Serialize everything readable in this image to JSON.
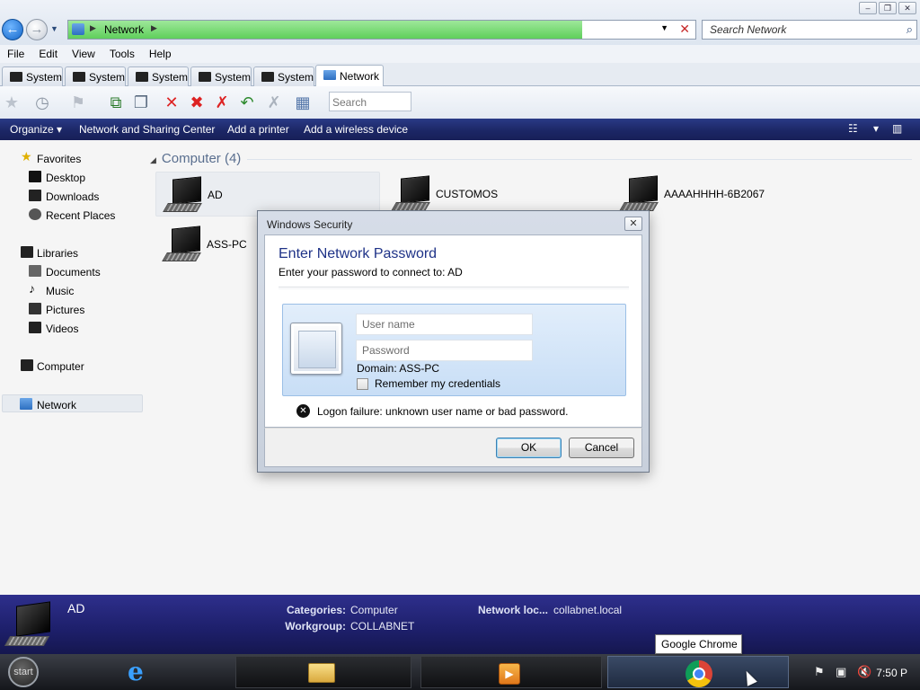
{
  "address_bar": {
    "breadcrumb": "Network",
    "search_placeholder": "Search Network"
  },
  "window_controls": {
    "minimize": "–",
    "maximize": "❐",
    "close": "✕"
  },
  "menu": [
    "File",
    "Edit",
    "View",
    "Tools",
    "Help"
  ],
  "tabs": [
    {
      "label": "System"
    },
    {
      "label": "System"
    },
    {
      "label": "System"
    },
    {
      "label": "System"
    },
    {
      "label": "System"
    },
    {
      "label": "Network",
      "active": true
    }
  ],
  "toolbar": {
    "search_placeholder": "Search"
  },
  "command_bar": {
    "items": [
      "Organize",
      "Network and Sharing Center",
      "Add a printer",
      "Add a wireless device"
    ],
    "organize_arrow": "▾",
    "view_arrow": "▾"
  },
  "nav_pane": {
    "favorites": {
      "label": "Favorites",
      "items": [
        "Desktop",
        "Downloads",
        "Recent Places"
      ]
    },
    "libraries": {
      "label": "Libraries",
      "items": [
        "Documents",
        "Music",
        "Pictures",
        "Videos"
      ]
    },
    "computer": "Computer",
    "network": "Network"
  },
  "content": {
    "group_header": "Computer (4)",
    "computers": [
      "AD",
      "CUSTOMOS",
      "AAAAHHHH-6B2067",
      "ASS-PC"
    ]
  },
  "dialog": {
    "title": "Windows Security",
    "heading": "Enter Network Password",
    "subtitle": "Enter your password to connect to: AD",
    "username_placeholder": "User name",
    "password_placeholder": "Password",
    "domain": "Domain: ASS-PC",
    "remember_label": "Remember my credentials",
    "remember_checked": false,
    "error": "Logon failure: unknown user name or bad password.",
    "ok_label": "OK",
    "cancel_label": "Cancel"
  },
  "details": {
    "name": "AD",
    "categories_key": "Categories:",
    "categories_val": "Computer",
    "workgroup_key": "Workgroup:",
    "workgroup_val": "COLLABNET",
    "netloc_key": "Network loc...",
    "netloc_val": "collabnet.local"
  },
  "taskbar": {
    "start_label": "start",
    "tooltip": "Google Chrome",
    "clock": "7:50 P"
  },
  "colors": {
    "command_bar": "#1c2766",
    "details_pane": "#1d1f6a",
    "dialog_heading": "#1e3287",
    "progress": "#5fcf5b"
  }
}
